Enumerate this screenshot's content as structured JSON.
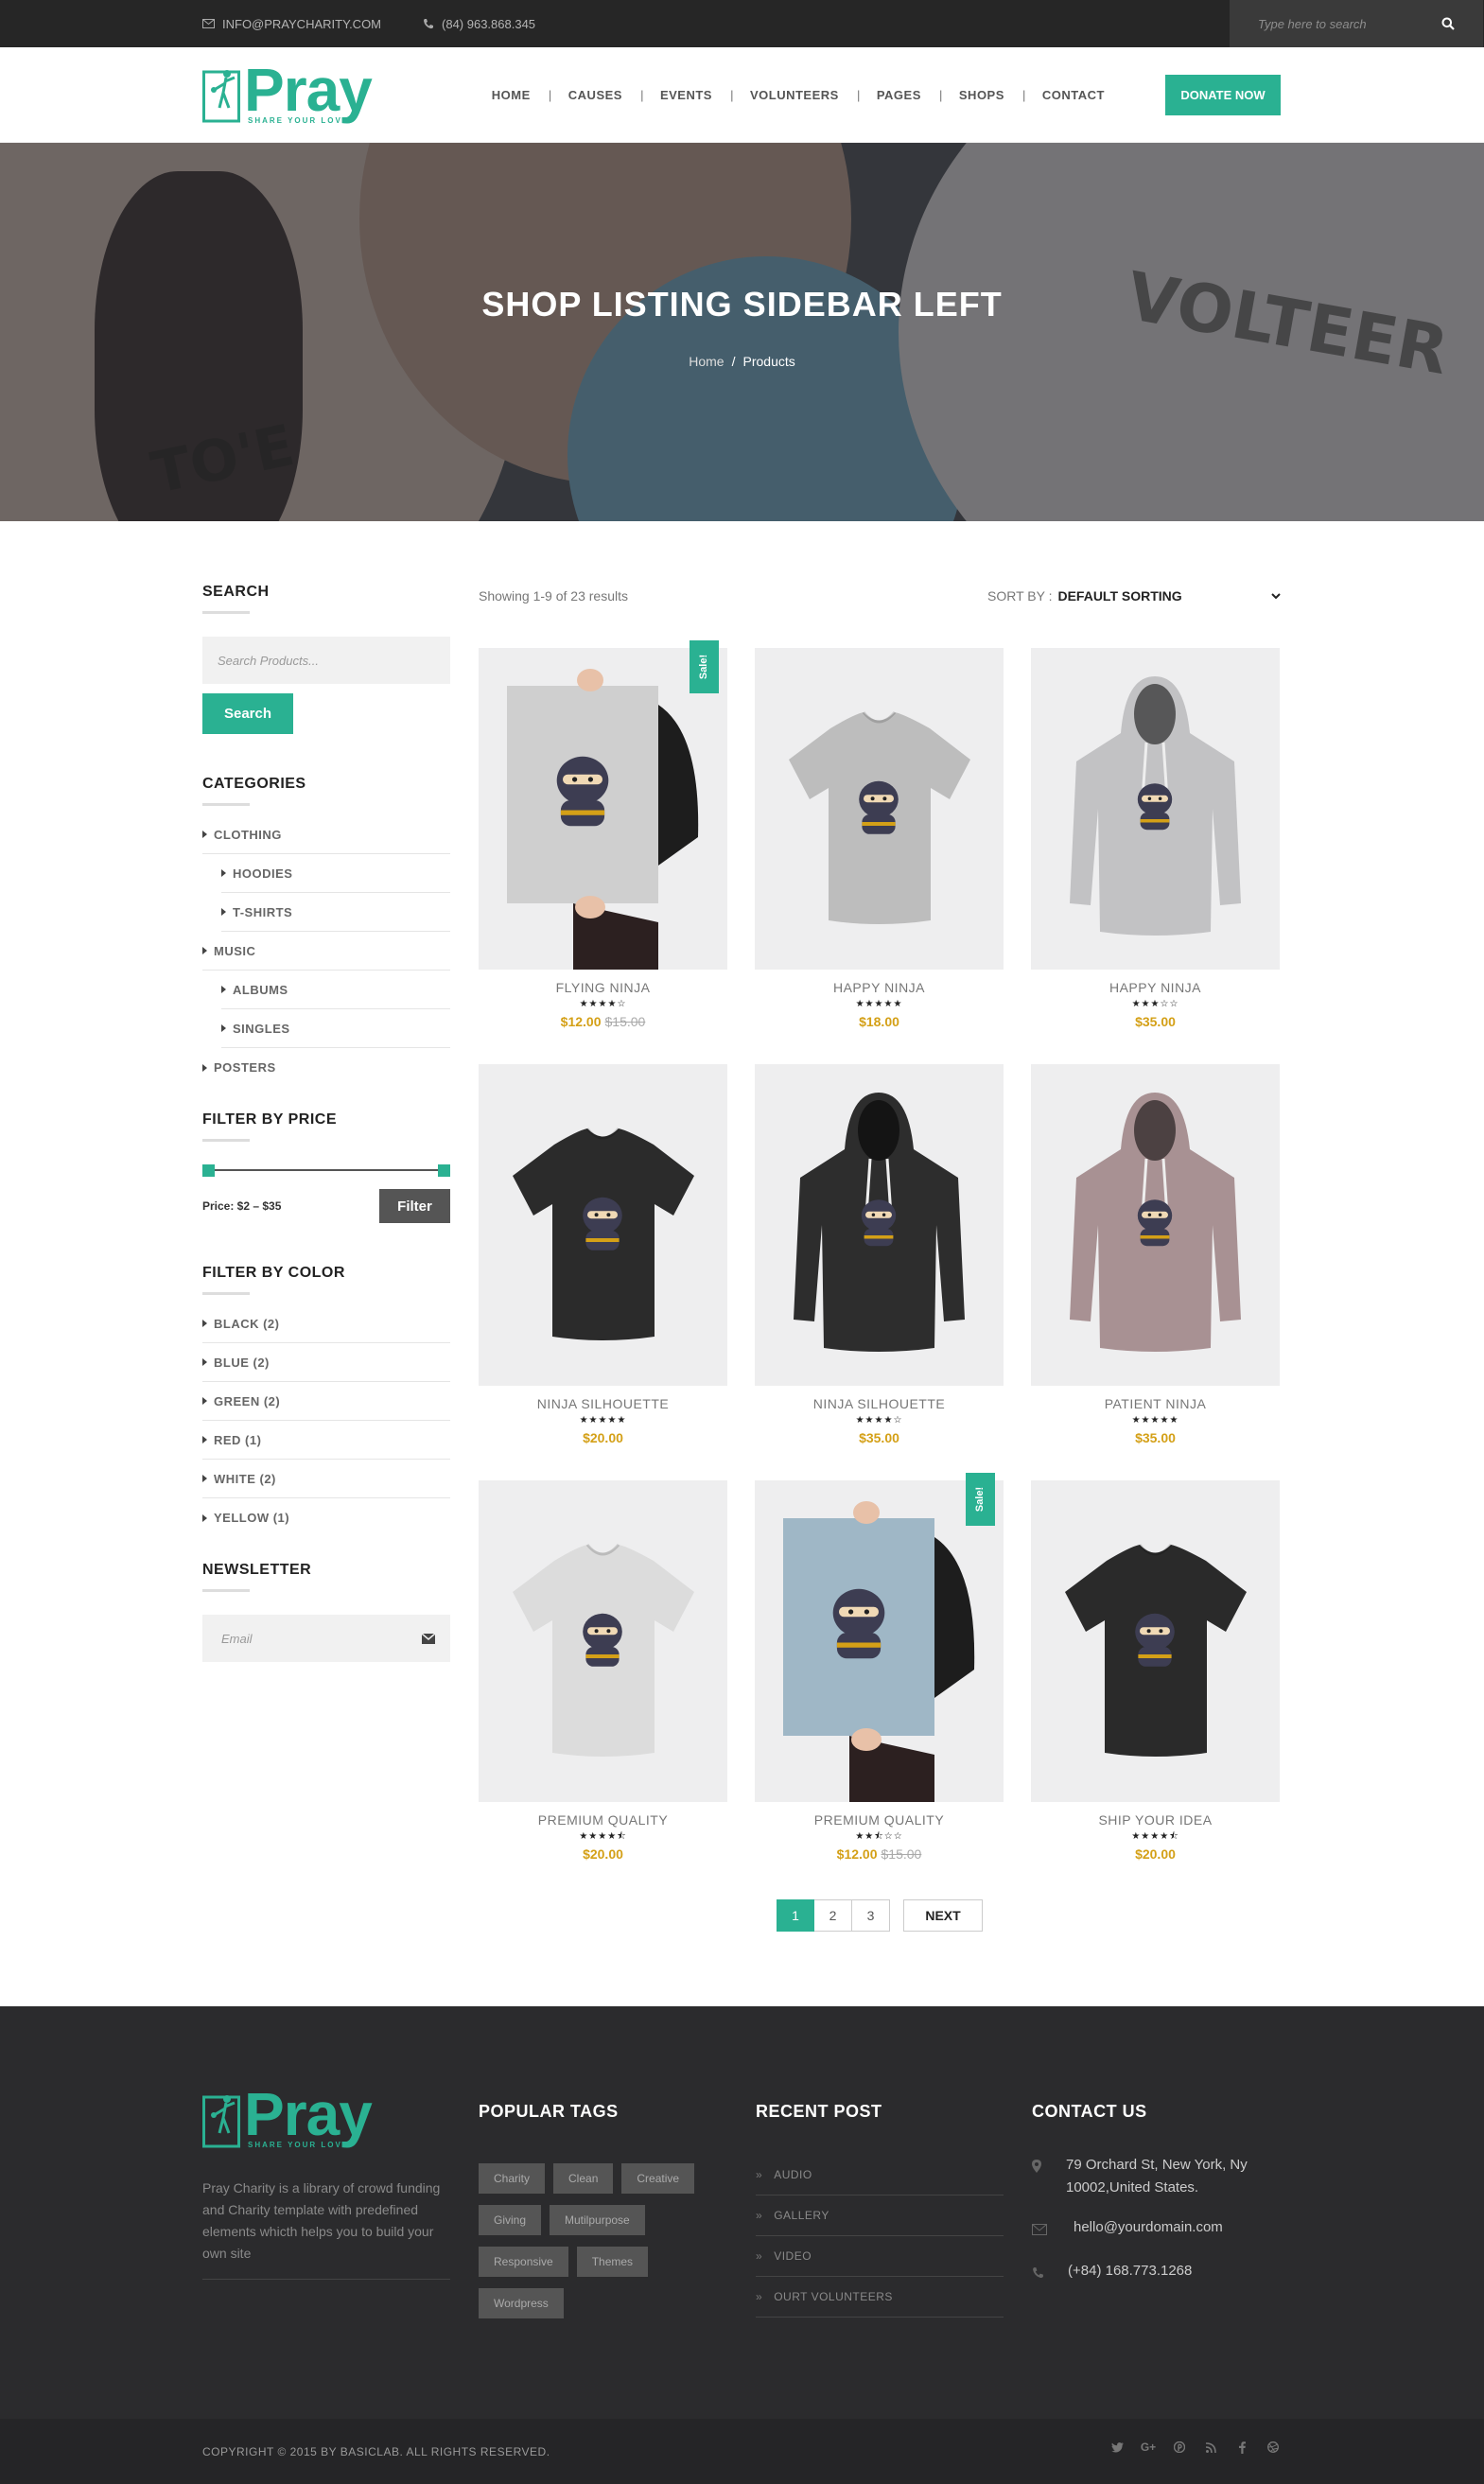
{
  "topbar": {
    "email": "INFO@PRAYCHARITY.COM",
    "phone": "(84) 963.868.345",
    "search_placeholder": "Type here to search"
  },
  "header": {
    "logo_word": "Pray",
    "logo_tagline": "SHARE YOUR LOVE",
    "nav": [
      "HOME",
      "CAUSES",
      "EVENTS",
      "VOLUNTEERS",
      "PAGES",
      "SHOPS",
      "CONTACT"
    ],
    "donate_label": "DONATE NOW"
  },
  "banner": {
    "title": "SHOP LISTING SIDEBAR LEFT",
    "breadcrumb_home": "Home",
    "breadcrumb_sep": "/",
    "breadcrumb_current": "Products"
  },
  "sidebar": {
    "search_title": "SEARCH",
    "search_placeholder": "Search Products...",
    "search_button": "Search",
    "categories_title": "CATEGORIES",
    "categories": [
      {
        "label": "CLOTHING",
        "sub": false
      },
      {
        "label": "HOODIES",
        "sub": true
      },
      {
        "label": "T-SHIRTS",
        "sub": true
      },
      {
        "label": "MUSIC",
        "sub": false
      },
      {
        "label": "ALBUMS",
        "sub": true
      },
      {
        "label": "SINGLES",
        "sub": true
      },
      {
        "label": "POSTERS",
        "sub": false
      }
    ],
    "price_title": "FILTER BY PRICE",
    "price_label": "Price: $2 – $35",
    "price_range": [
      2,
      35
    ],
    "filter_button": "Filter",
    "color_title": "FILTER BY COLOR",
    "colors": [
      "BLACK (2)",
      "BLUE (2)",
      "GREEN (2)",
      "RED (1)",
      "WHITE (2)",
      "YELLOW (1)"
    ],
    "newsletter_title": "NEWSLETTER",
    "newsletter_placeholder": "Email"
  },
  "content": {
    "result_count": "Showing 1-9 of 23 results",
    "sort_label": "SORT BY :",
    "sort_value": "DEFAULT SORTING",
    "products": [
      {
        "name": "FLYING NINJA",
        "rating": 4,
        "price": "$12.00",
        "old_price": "$15.00",
        "sale": true,
        "kind": "poster",
        "color": "#cfcfcf"
      },
      {
        "name": "HAPPY NINJA",
        "rating": 5,
        "price": "$18.00",
        "old_price": "",
        "sale": false,
        "kind": "tshirt",
        "color": "#bdbdbd"
      },
      {
        "name": "HAPPY NINJA",
        "rating": 3,
        "price": "$35.00",
        "old_price": "",
        "sale": false,
        "kind": "hoodie",
        "color": "#c2c2c4"
      },
      {
        "name": "NINJA SILHOUETTE",
        "rating": 5,
        "price": "$20.00",
        "old_price": "",
        "sale": false,
        "kind": "tshirt",
        "color": "#2b2b2b"
      },
      {
        "name": "NINJA SILHOUETTE",
        "rating": 4,
        "price": "$35.00",
        "old_price": "",
        "sale": false,
        "kind": "hoodie",
        "color": "#2d2d2d"
      },
      {
        "name": "PATIENT NINJA",
        "rating": 5,
        "price": "$35.00",
        "old_price": "",
        "sale": false,
        "kind": "hoodie",
        "color": "#a89193"
      },
      {
        "name": "PREMIUM QUALITY",
        "rating": 4.5,
        "price": "$20.00",
        "old_price": "",
        "sale": false,
        "kind": "tshirt",
        "color": "#dcdcdc"
      },
      {
        "name": "PREMIUM QUALITY",
        "rating": 2.5,
        "price": "$12.00",
        "old_price": "$15.00",
        "sale": true,
        "kind": "poster",
        "color": "#9fb7c6"
      },
      {
        "name": "SHIP YOUR IDEA",
        "rating": 4.5,
        "price": "$20.00",
        "old_price": "",
        "sale": false,
        "kind": "tshirt",
        "color": "#2a2a2a"
      }
    ],
    "sale_label": "Sale!",
    "pages": [
      "1",
      "2",
      "3"
    ],
    "next_label": "NEXT"
  },
  "footer": {
    "logo_word": "Pray",
    "logo_tagline": "SHARE YOUR LOVE",
    "description": "Pray Charity is a library of crowd funding and Charity template with predefined elements whicth helps you to build your own site",
    "tags_title": "POPULAR TAGS",
    "tags": [
      "Charity",
      "Clean",
      "Creative",
      "Giving",
      "Mutilpurpose",
      "Responsive",
      "Themes",
      "Wordpress"
    ],
    "posts_title": "RECENT POST",
    "posts": [
      "AUDIO",
      "GALLERY",
      "VIDEO",
      "OURT VOLUNTEERS"
    ],
    "contact_title": "CONTACT US",
    "address": "79 Orchard St, New York, Ny 10002,United States.",
    "email": "hello@yourdomain.com",
    "phone": "(+84) 168.773.1268",
    "copyright": "COPYRIGHT © 2015 BY BASICLAB. ALL RIGHTS RESERVED.",
    "socials": [
      "twitter-icon",
      "google-plus-icon",
      "pinterest-icon",
      "rss-icon",
      "facebook-icon",
      "dribbble-icon"
    ]
  },
  "colors": {
    "accent": "#2ab192",
    "price": "#d4a017",
    "dark": "#262626"
  }
}
